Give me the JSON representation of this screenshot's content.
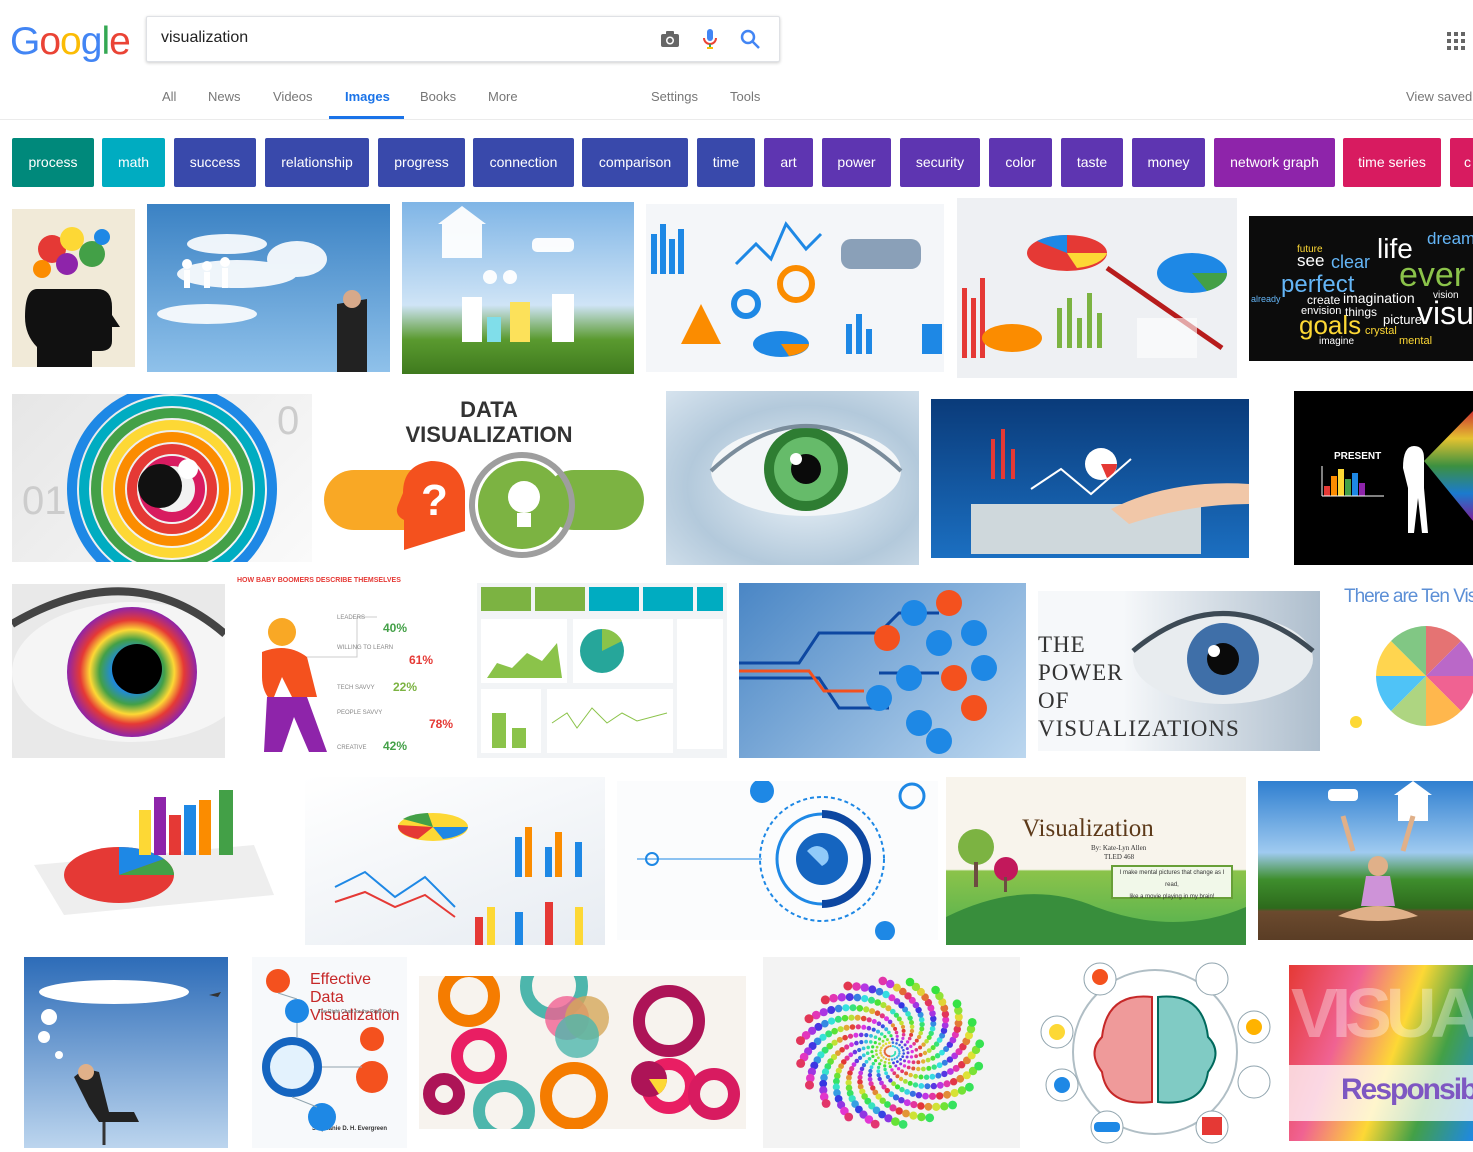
{
  "header": {
    "logo_text": "Google",
    "search_query": "visualization",
    "view_saved_label": "View saved"
  },
  "nav": {
    "tabs": [
      "All",
      "News",
      "Videos",
      "Images",
      "Books",
      "More"
    ],
    "settings_label": "Settings",
    "tools_label": "Tools",
    "active_tab": "Images"
  },
  "chips": [
    {
      "label": "process",
      "color": "#00897b"
    },
    {
      "label": "math",
      "color": "#00acc1"
    },
    {
      "label": "success",
      "color": "#3949ab"
    },
    {
      "label": "relationship",
      "color": "#3949ab"
    },
    {
      "label": "progress",
      "color": "#3949ab"
    },
    {
      "label": "connection",
      "color": "#3949ab"
    },
    {
      "label": "comparison",
      "color": "#3949ab"
    },
    {
      "label": "time",
      "color": "#3949ab"
    },
    {
      "label": "art",
      "color": "#5e35b1"
    },
    {
      "label": "power",
      "color": "#5e35b1"
    },
    {
      "label": "security",
      "color": "#5e35b1"
    },
    {
      "label": "color",
      "color": "#5e35b1"
    },
    {
      "label": "taste",
      "color": "#5e35b1"
    },
    {
      "label": "money",
      "color": "#5e35b1"
    },
    {
      "label": "network graph",
      "color": "#8e24aa"
    },
    {
      "label": "time series",
      "color": "#d81b60"
    },
    {
      "label": "c",
      "color": "#d81b60"
    }
  ],
  "image_text": {
    "data_viz_line1": "DATA",
    "data_viz_line2": "VISUALIZATION",
    "present_label": "PRESENT",
    "power_line1": "THE",
    "power_line2": "POWER",
    "power_line3": "OF",
    "power_line4": "VISUALIZATIONS",
    "ten_visual": "There are Ten Visua",
    "visualization_title": "Visualization",
    "visualization_byline": "By: Kate-Lyn Allen",
    "visualization_course": "TLED 468",
    "visualization_quote1": "I make mental pictures that change as I read,",
    "visualization_quote2": "like a movie playing in my brain!",
    "effective_line1": "Effective Data",
    "effective_line2": "Visualization",
    "effective_sub": "The Right Chart for the Right Data",
    "effective_author": "Stephanie D. H. Evergreen",
    "boomers_title": "HOW BABY BOOMERS DESCRIBE THEMSELVES",
    "boomers_pcts": [
      "40%",
      "61%",
      "22%",
      "78%",
      "42%"
    ],
    "boomers_labels": [
      "LEADERS",
      "WILLING TO LEARN",
      "TECH SAVVY",
      "PEOPLE SAVVY",
      "CREATIVE"
    ],
    "visual_word": "VISUA",
    "responsibly_word": "Responsibly",
    "wordcloud": [
      "life",
      "dreams",
      "see",
      "clear",
      "future",
      "perfect",
      "ever",
      "create",
      "imagination",
      "goals",
      "vision",
      "visu",
      "picture",
      "imagine",
      "crystal",
      "mental",
      "already",
      "envision",
      "things"
    ]
  }
}
